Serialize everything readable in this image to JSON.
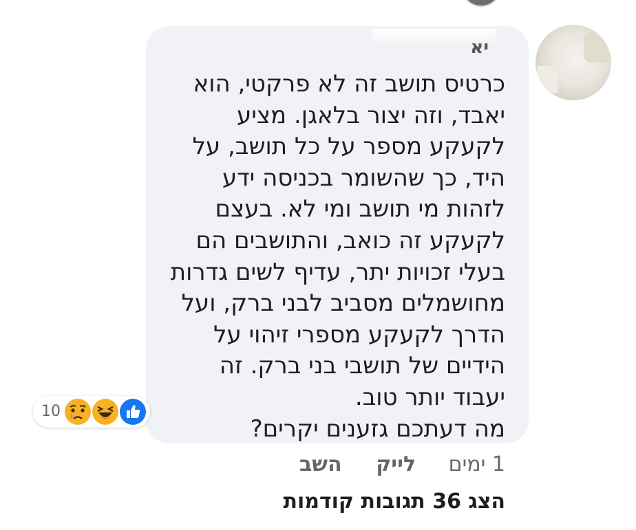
{
  "comment": {
    "author_partial": "יא",
    "lines": [
      "כרטיס תושב זה לא פרקטי, הוא",
      "יאבד, וזה יצור בלאגן.  מציע",
      "לקעקע מספר על כל תושב, על",
      "היד, כך שהשומר בכניסה ידע",
      "לזהות מי תושב ומי לא. בעצם",
      "לקעקע זה כואב, והתושבים הם",
      "בעלי זכויות יתר, עדיף לשים גדרות",
      "מחושמלים מסביב לבני ברק, ועל",
      "הדרך לקעקע מספרי זיהוי על",
      "הידיים של תושבי בני ברק.  זה",
      "יעבוד יותר טוב.",
      "מה דעתכם גזענים יקרים?"
    ]
  },
  "reactions": {
    "count": "10",
    "icons": [
      "sad-icon",
      "haha-icon",
      "like-icon"
    ]
  },
  "actions": {
    "time": "1 ימים",
    "like": "לייק",
    "reply": "השב"
  },
  "view_previous": "הצג 36 תגובות קודמות"
}
